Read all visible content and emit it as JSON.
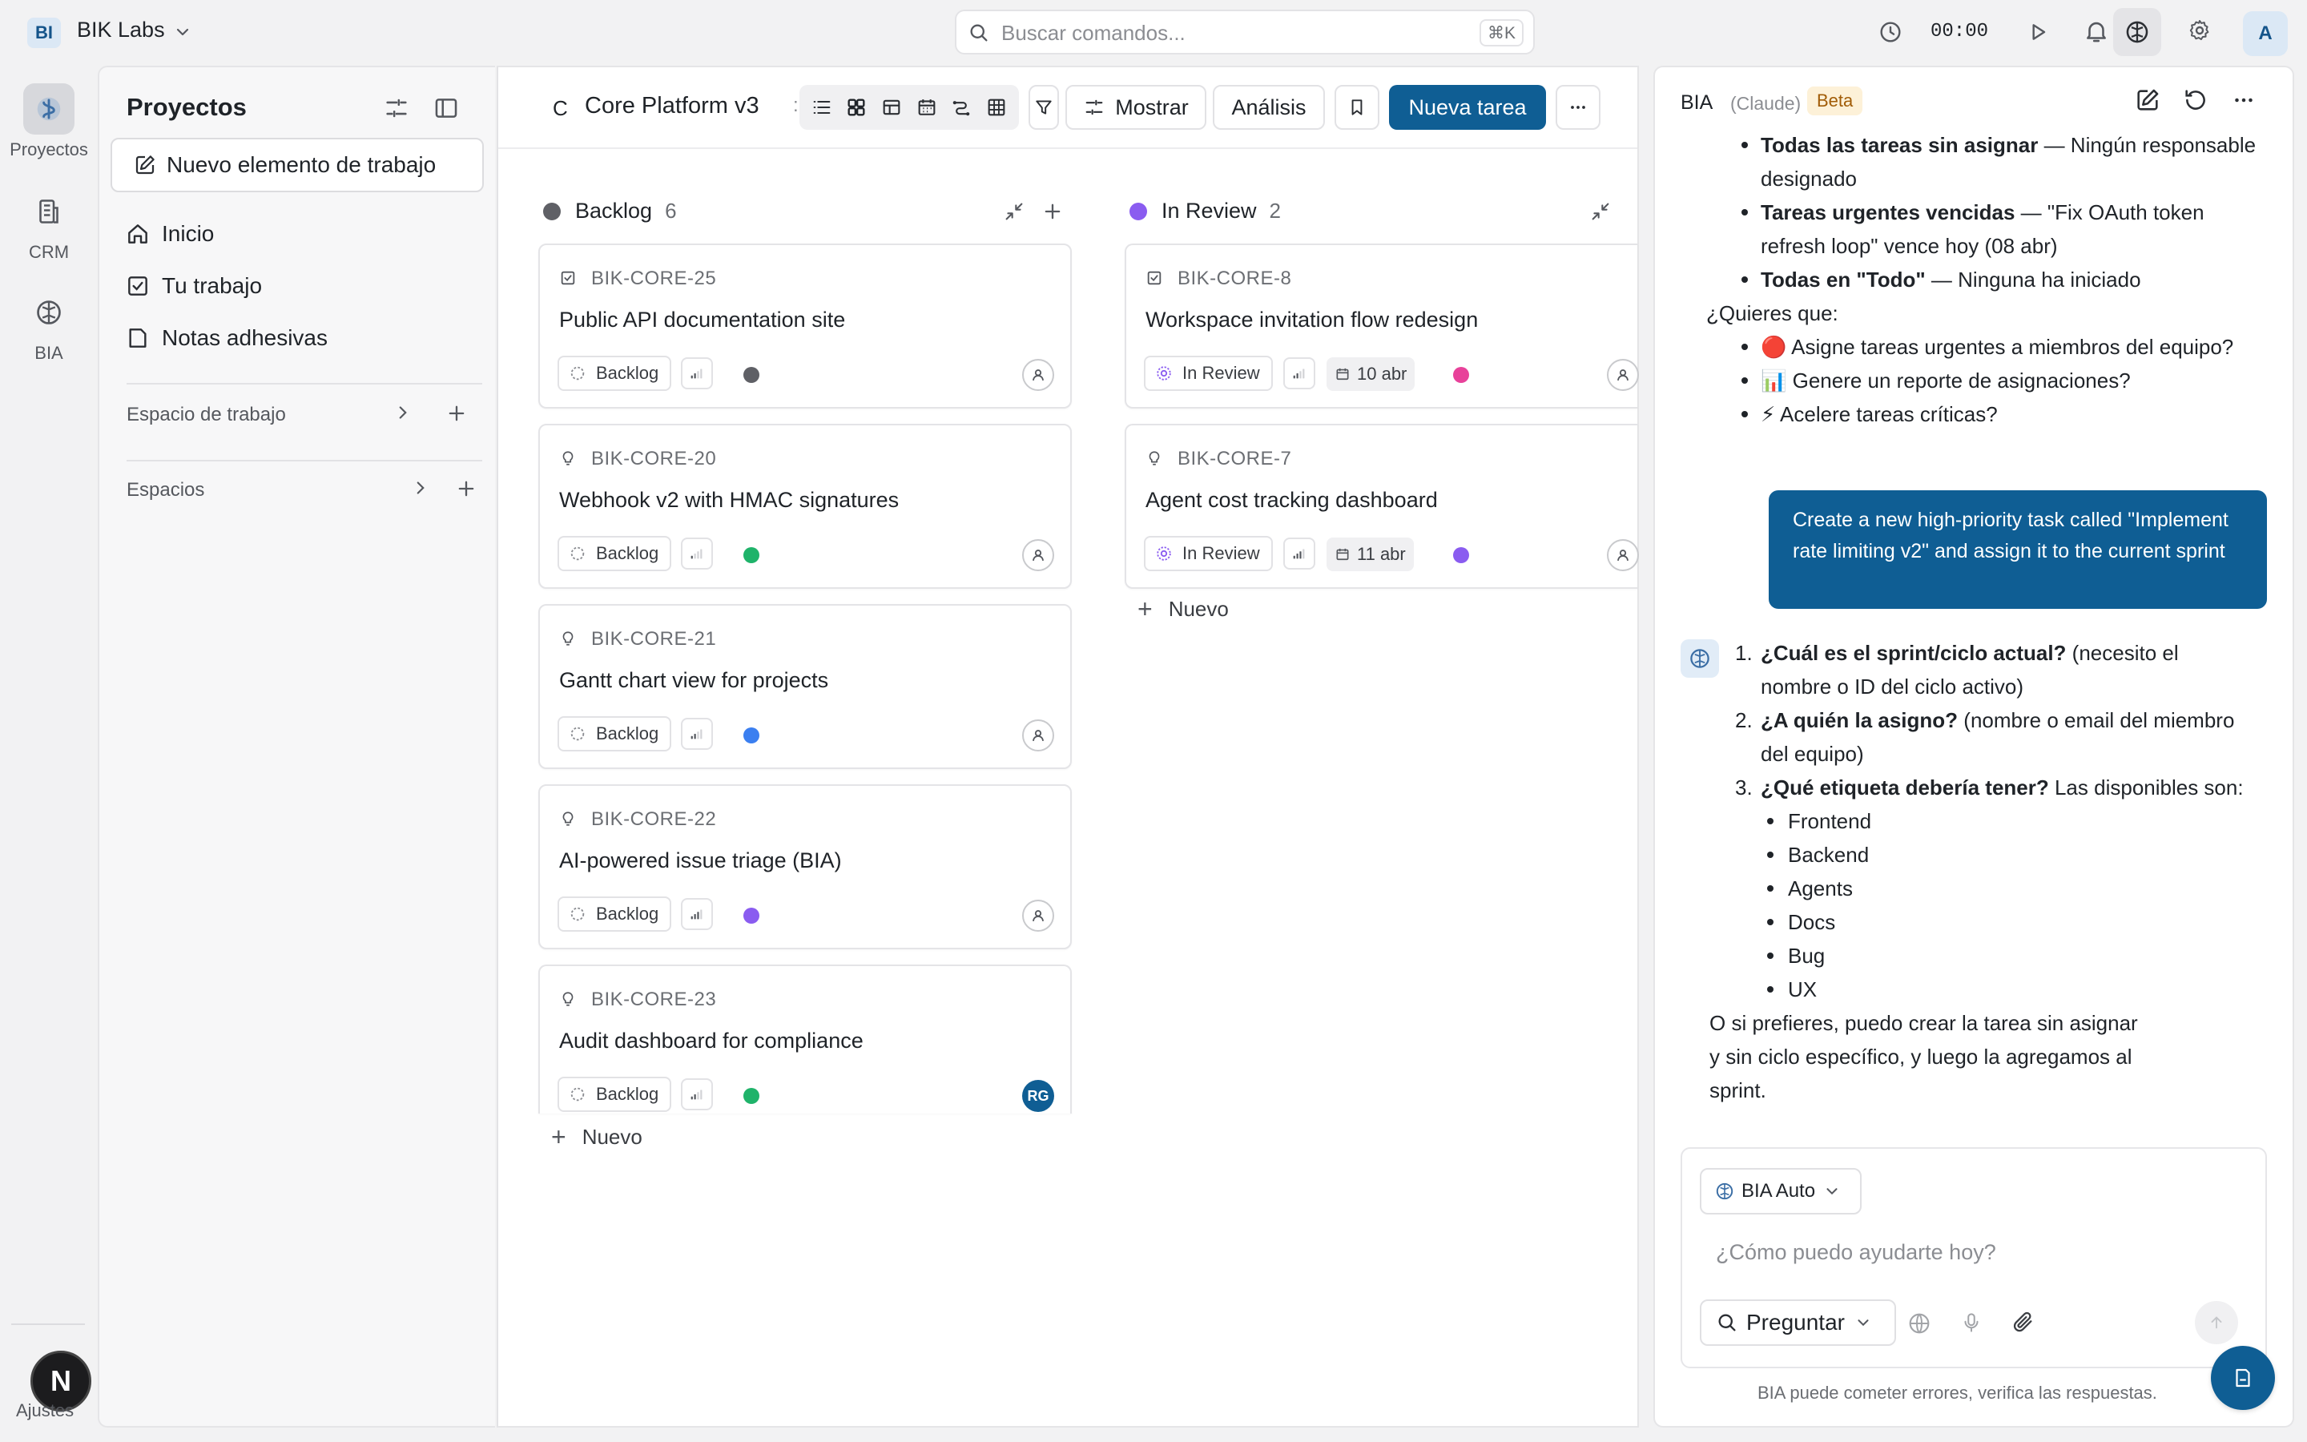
{
  "workspace": {
    "badge": "BI",
    "name": "BIK Labs"
  },
  "command_search": {
    "placeholder": "Buscar comandos...",
    "shortcut": "⌘K"
  },
  "timer": "00:00",
  "user_avatar": "A",
  "rail": {
    "items": [
      {
        "label": "Proyectos",
        "icon": "projects-icon",
        "active": true
      },
      {
        "label": "CRM",
        "icon": "crm-icon",
        "active": false
      },
      {
        "label": "BIA",
        "icon": "brain-icon",
        "active": false
      }
    ],
    "bottom_avatar": "N",
    "settings_label": "Ajustes"
  },
  "sidebar": {
    "title": "Proyectos",
    "new_item_label": "Nuevo elemento de trabajo",
    "nav": [
      {
        "label": "Inicio",
        "icon": "home-icon"
      },
      {
        "label": "Tu trabajo",
        "icon": "checkbox-icon"
      },
      {
        "label": "Notas adhesivas",
        "icon": "note-icon"
      }
    ],
    "sections": [
      {
        "label": "Espacio de trabajo"
      },
      {
        "label": "Espacios"
      }
    ]
  },
  "board": {
    "project_letter": "C",
    "project_name": "Core Platform v3",
    "separator": ":",
    "buttons": {
      "show": "Mostrar",
      "analysis": "Análisis",
      "new_task": "Nueva tarea"
    },
    "columns": [
      {
        "title": "Backlog",
        "count": "6",
        "dot_color": "#5f6066",
        "add_label": "Nuevo",
        "cards": [
          {
            "id": "BIK-CORE-25",
            "type": "task",
            "title": "Public API documentation site",
            "state": "Backlog",
            "priority_level": 1,
            "label_color": "#5f6066",
            "assignee": ""
          },
          {
            "id": "BIK-CORE-20",
            "type": "idea",
            "title": "Webhook v2 with HMAC signatures",
            "state": "Backlog",
            "priority_level": 0,
            "label_color": "#1fb36a",
            "assignee": ""
          },
          {
            "id": "BIK-CORE-21",
            "type": "idea",
            "title": "Gantt chart view for projects",
            "state": "Backlog",
            "priority_level": 1,
            "label_color": "#3b7ff0",
            "assignee": ""
          },
          {
            "id": "BIK-CORE-22",
            "type": "idea",
            "title": "AI-powered issue triage (BIA)",
            "state": "Backlog",
            "priority_level": 2,
            "label_color": "#8a5cf0",
            "assignee": ""
          },
          {
            "id": "BIK-CORE-23",
            "type": "idea",
            "title": "Audit dashboard for compliance",
            "state": "Backlog",
            "priority_level": 1,
            "label_color": "#1fb36a",
            "assignee": "RG"
          }
        ]
      },
      {
        "title": "In Review",
        "count": "2",
        "dot_color": "#8a5cf0",
        "add_label": "Nuevo",
        "cards": [
          {
            "id": "BIK-CORE-8",
            "type": "task",
            "title": "Workspace invitation flow redesign",
            "state": "In Review",
            "priority_level": 1,
            "date": "10 abr",
            "label_color": "#e8419a",
            "assignee": ""
          },
          {
            "id": "BIK-CORE-7",
            "type": "idea",
            "title": "Agent cost tracking dashboard",
            "state": "In Review",
            "priority_level": 2,
            "date": "11 abr",
            "label_color": "#8a5cf0",
            "assignee": ""
          }
        ]
      }
    ]
  },
  "chat": {
    "title": "BIA",
    "model": "(Claude)",
    "badge": "Beta",
    "summary": [
      {
        "bold": "Todas las tareas sin asignar",
        "text": " — Ningún responsable designado"
      },
      {
        "bold": "Tareas urgentes vencidas",
        "text": " — \"Fix OAuth token refresh loop\" vence hoy (08 abr)"
      },
      {
        "bold": "Todas en \"Todo\"",
        "text": " — Ninguna ha iniciado"
      }
    ],
    "question": "¿Quieres que:",
    "options": [
      "🔴 Asigne tareas urgentes a miembros del equipo?",
      "📊 Genere un reporte de asignaciones?",
      "⚡ Acelere tareas críticas?"
    ],
    "user_message": "Create a new high-priority task called \"Implement rate limiting v2\" and assign it to the current sprint",
    "answer_items": [
      {
        "n": "1.",
        "bold": "¿Cuál es el sprint/ciclo actual?",
        "text": " (necesito el nombre o ID del ciclo activo)"
      },
      {
        "n": "2.",
        "bold": "¿A quién la asigno?",
        "text": " (nombre o email del miembro del equipo)"
      },
      {
        "n": "3.",
        "bold": "¿Qué etiqueta debería tener?",
        "text": " Las disponibles son:"
      }
    ],
    "labels": [
      "Frontend",
      "Backend",
      "Agents",
      "Docs",
      "Bug",
      "UX"
    ],
    "closing": "O si prefieres, puedo crear la tarea sin asignar y sin ciclo específico, y luego la agregamos al sprint.",
    "mode_label": "BIA Auto",
    "input_placeholder": "¿Cómo puedo ayudarte hoy?",
    "ask_label": "Preguntar",
    "disclaimer": "BIA puede cometer errores, verifica las respuestas."
  },
  "colors": {
    "accent": "#0f5e94",
    "beta_bg": "#fdf1d8",
    "beta_text": "#a15c07"
  }
}
